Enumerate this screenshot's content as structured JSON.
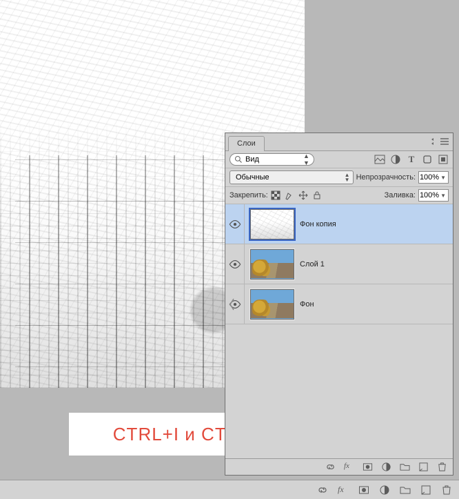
{
  "annotation_text": "CTRL+I и CTRL+SHIFT+U",
  "panel": {
    "tab_label": "Слои",
    "search_placeholder": "Вид",
    "blend_mode": "Обычные",
    "opacity_label": "Непрозрачность:",
    "opacity_value": "100%",
    "lock_label": "Закрепить:",
    "fill_label": "Заливка:",
    "fill_value": "100%"
  },
  "layers": [
    {
      "name": "Фон копия",
      "visible": true,
      "selected": true,
      "thumb": "sketch"
    },
    {
      "name": "Слой 1",
      "visible": true,
      "selected": false,
      "thumb": "photo"
    },
    {
      "name": "Фон",
      "visible": true,
      "selected": false,
      "thumb": "photo"
    }
  ],
  "filter_icons": [
    "image-filter-icon",
    "adjustments-filter-icon",
    "text-filter-icon",
    "shape-filter-icon",
    "smartobj-filter-icon"
  ],
  "lock_icons": [
    "lock-transparent-icon",
    "lock-pixels-icon",
    "lock-position-icon",
    "lock-all-icon"
  ],
  "bottom_icons": [
    "link-layers-icon",
    "layer-style-icon",
    "layer-mask-icon",
    "adjustment-layer-icon",
    "new-group-icon",
    "new-layer-icon",
    "delete-layer-icon"
  ],
  "status_icons": [
    "link-icon",
    "fx-icon",
    "mask-icon",
    "adjust-icon",
    "folder-icon",
    "page-icon",
    "trash-icon"
  ]
}
